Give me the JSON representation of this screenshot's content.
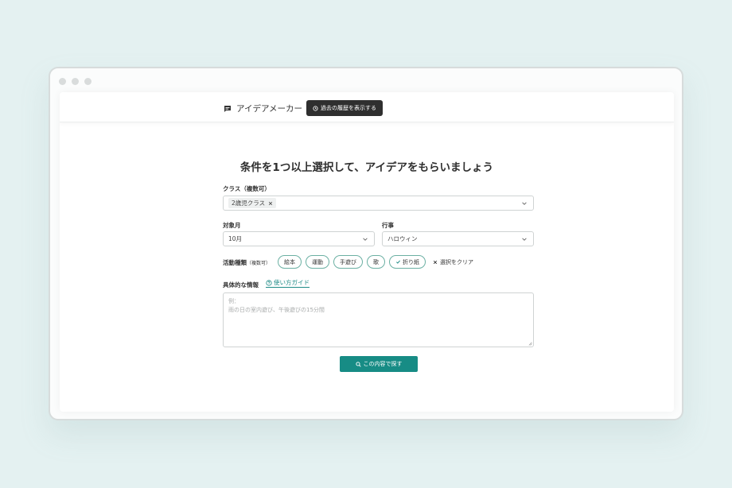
{
  "app": {
    "title": "アイデアメーカー",
    "history_button": "過去の履歴を表示する"
  },
  "form": {
    "heading": "条件を1つ以上選択して、アイデアをもらいましょう",
    "class": {
      "label": "クラス",
      "label_note": "（複数可）",
      "selected_tag": "2歳児クラス"
    },
    "month": {
      "label": "対象月",
      "value": "10月"
    },
    "event": {
      "label": "行事",
      "value": "ハロウィン"
    },
    "activity": {
      "label": "活動種類",
      "label_note": "（複数可）",
      "chips": [
        {
          "label": "絵本",
          "selected": false
        },
        {
          "label": "運動",
          "selected": false
        },
        {
          "label": "手遊び",
          "selected": false
        },
        {
          "label": "歌",
          "selected": false
        },
        {
          "label": "折り紙",
          "selected": true
        }
      ],
      "clear_label": "選択をクリア"
    },
    "details": {
      "label": "具体的な情報",
      "guide_link": "使い方ガイド",
      "placeholder_line1": "例：",
      "placeholder_line2": "雨の日の室内遊び、午後遊びの15分間"
    },
    "submit_label": "この内容で探す"
  },
  "colors": {
    "accent": "#178c85",
    "chip_border": "#6bb0a3",
    "dark_button": "#2f2f2f",
    "background": "#e4f1f1"
  },
  "icons": [
    "message-icon",
    "history-icon",
    "chevron-down-icon",
    "close-icon",
    "check-icon",
    "help-circle-icon",
    "search-icon",
    "resize-grip-icon"
  ]
}
